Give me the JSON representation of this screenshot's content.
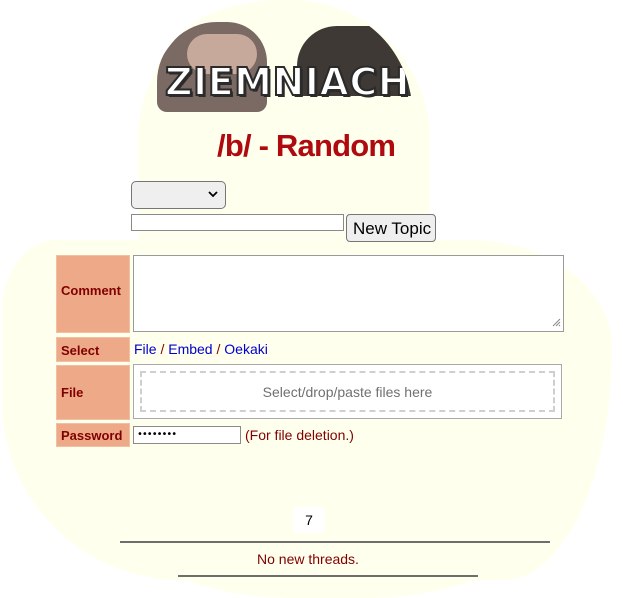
{
  "banner": {
    "text": "ZIEMNIACHA"
  },
  "board": {
    "title": "/b/ - Random"
  },
  "board_select": {
    "value": "",
    "icon": "chevron-down-icon"
  },
  "subject": {
    "value": ""
  },
  "new_topic_button": {
    "label": "New Topic"
  },
  "form": {
    "comment_label": "Comment",
    "select_label": "Select",
    "file_label": "File",
    "password_label": "Password",
    "embed_links": {
      "file": "File",
      "sep1": " / ",
      "embed": "Embed",
      "sep2": " / ",
      "oekaki": "Oekaki"
    },
    "dropzone_text": "Select/drop/paste files here",
    "password_value": "••••••••",
    "password_note": "(For file deletion.)"
  },
  "pagination": {
    "current": "7"
  },
  "threads": {
    "empty_message": "No new threads."
  }
}
